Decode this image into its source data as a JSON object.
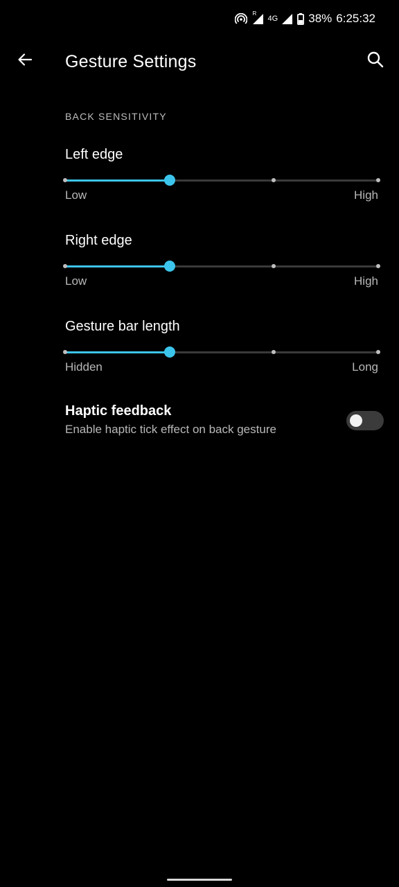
{
  "status_bar": {
    "roaming_mark": "R",
    "network": "4G",
    "battery": "38%",
    "time": "6:25:32"
  },
  "app_bar": {
    "title": "Gesture Settings",
    "back_icon": "arrow-left-icon",
    "search_icon": "search-icon"
  },
  "section": {
    "header": "BACK SENSITIVITY"
  },
  "sliders": [
    {
      "title": "Left edge",
      "min_label": "Low",
      "max_label": "High",
      "steps": 4,
      "value_step": 1
    },
    {
      "title": "Right edge",
      "min_label": "Low",
      "max_label": "High",
      "steps": 4,
      "value_step": 1
    },
    {
      "title": "Gesture bar length",
      "min_label": "Hidden",
      "max_label": "Long",
      "steps": 4,
      "value_step": 1
    }
  ],
  "haptic": {
    "title": "Haptic feedback",
    "subtitle": "Enable haptic tick effect on back gesture",
    "enabled": false
  },
  "colors": {
    "accent": "#3cc5ec",
    "background": "#000000",
    "track": "#3a3a3a"
  }
}
